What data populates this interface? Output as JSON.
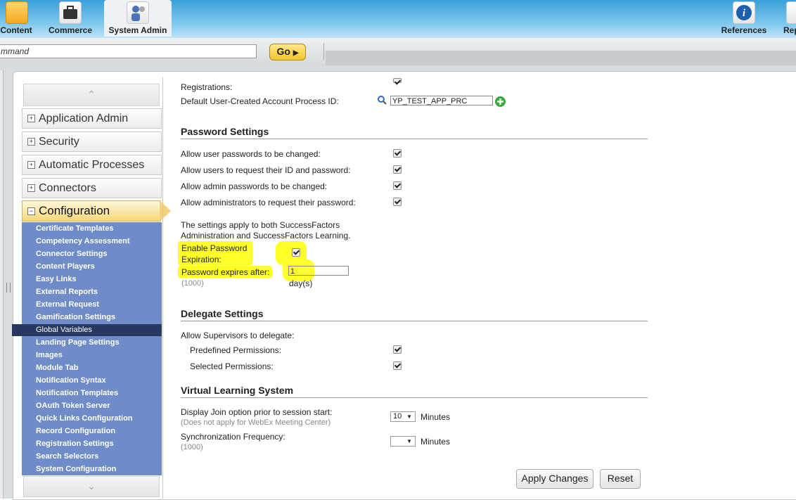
{
  "nav": {
    "items": [
      {
        "label": "Content",
        "icon": "folder-icon"
      },
      {
        "label": "Commerce",
        "icon": "briefcase-icon"
      },
      {
        "label": "System Admin",
        "icon": "admin-gear-icon"
      },
      {
        "label": "References",
        "icon": "info-icon"
      },
      {
        "label": "Rep",
        "icon": "report-icon"
      }
    ]
  },
  "command": {
    "value": "mmand",
    "go_label": "Go"
  },
  "sidebar": {
    "sections": [
      {
        "label": "Application Admin",
        "state": "+"
      },
      {
        "label": "Security",
        "state": "+"
      },
      {
        "label": "Automatic Processes",
        "state": "+"
      },
      {
        "label": "Connectors",
        "state": "+"
      },
      {
        "label": "Configuration",
        "state": "−"
      }
    ],
    "submenu": [
      "Certificate Templates",
      "Competency Assessment",
      "Connector Settings",
      "Content Players",
      "Easy Links",
      "External Reports",
      "External Request",
      "Gamification Settings",
      "Global Variables",
      "Landing Page Settings",
      "Images",
      "Module Tab",
      "Notification Syntax",
      "Notification Templates",
      "OAuth Token Server",
      "Quick Links Configuration",
      "Record Configuration",
      "Registration Settings",
      "Search Selectors",
      "System Configuration"
    ],
    "selected": "Global Variables"
  },
  "content": {
    "registrations_label": "Registrations:",
    "process_id_label": "Default User-Created Account Process ID:",
    "process_id_value": "YP_TEST_APP_PRC",
    "password": {
      "title": "Password Settings",
      "rows": [
        "Allow user passwords to be changed:",
        "Allow users to request their ID and password:",
        "Allow admin passwords to be changed:",
        "Allow administrators to request their password:"
      ],
      "note_line1": "The settings apply to both SuccessFactors",
      "note_line2": "Administration and SuccessFactors Learning.",
      "enable_line1": "Enable Password",
      "enable_line2": "Expiration:",
      "expires_label": "Password expires after:",
      "expires_value": "1",
      "expires_hint": "(1000)",
      "expires_unit": "day(s)"
    },
    "delegate": {
      "title": "Delegate Settings",
      "intro": "Allow Supervisors to delegate:",
      "predefined": "Predefined Permissions:",
      "selected": "Selected Permissions:"
    },
    "vls": {
      "title": "Virtual Learning System",
      "join_label": "Display Join option prior to session start:",
      "join_hint": "(Does not apply for WebEx Meeting Center)",
      "join_value": "10",
      "join_unit": "Minutes",
      "sync_label": "Synchronization Frequency:",
      "sync_hint": "(1000)",
      "sync_value": "",
      "sync_unit": "Minutes"
    },
    "apply_label": "Apply Changes",
    "reset_label": "Reset"
  },
  "colors": {
    "highlight": "#ffff2a",
    "submenu_bg": "#6f8cc8",
    "selected_bg": "#26385f",
    "accent": "#f5d77a"
  }
}
